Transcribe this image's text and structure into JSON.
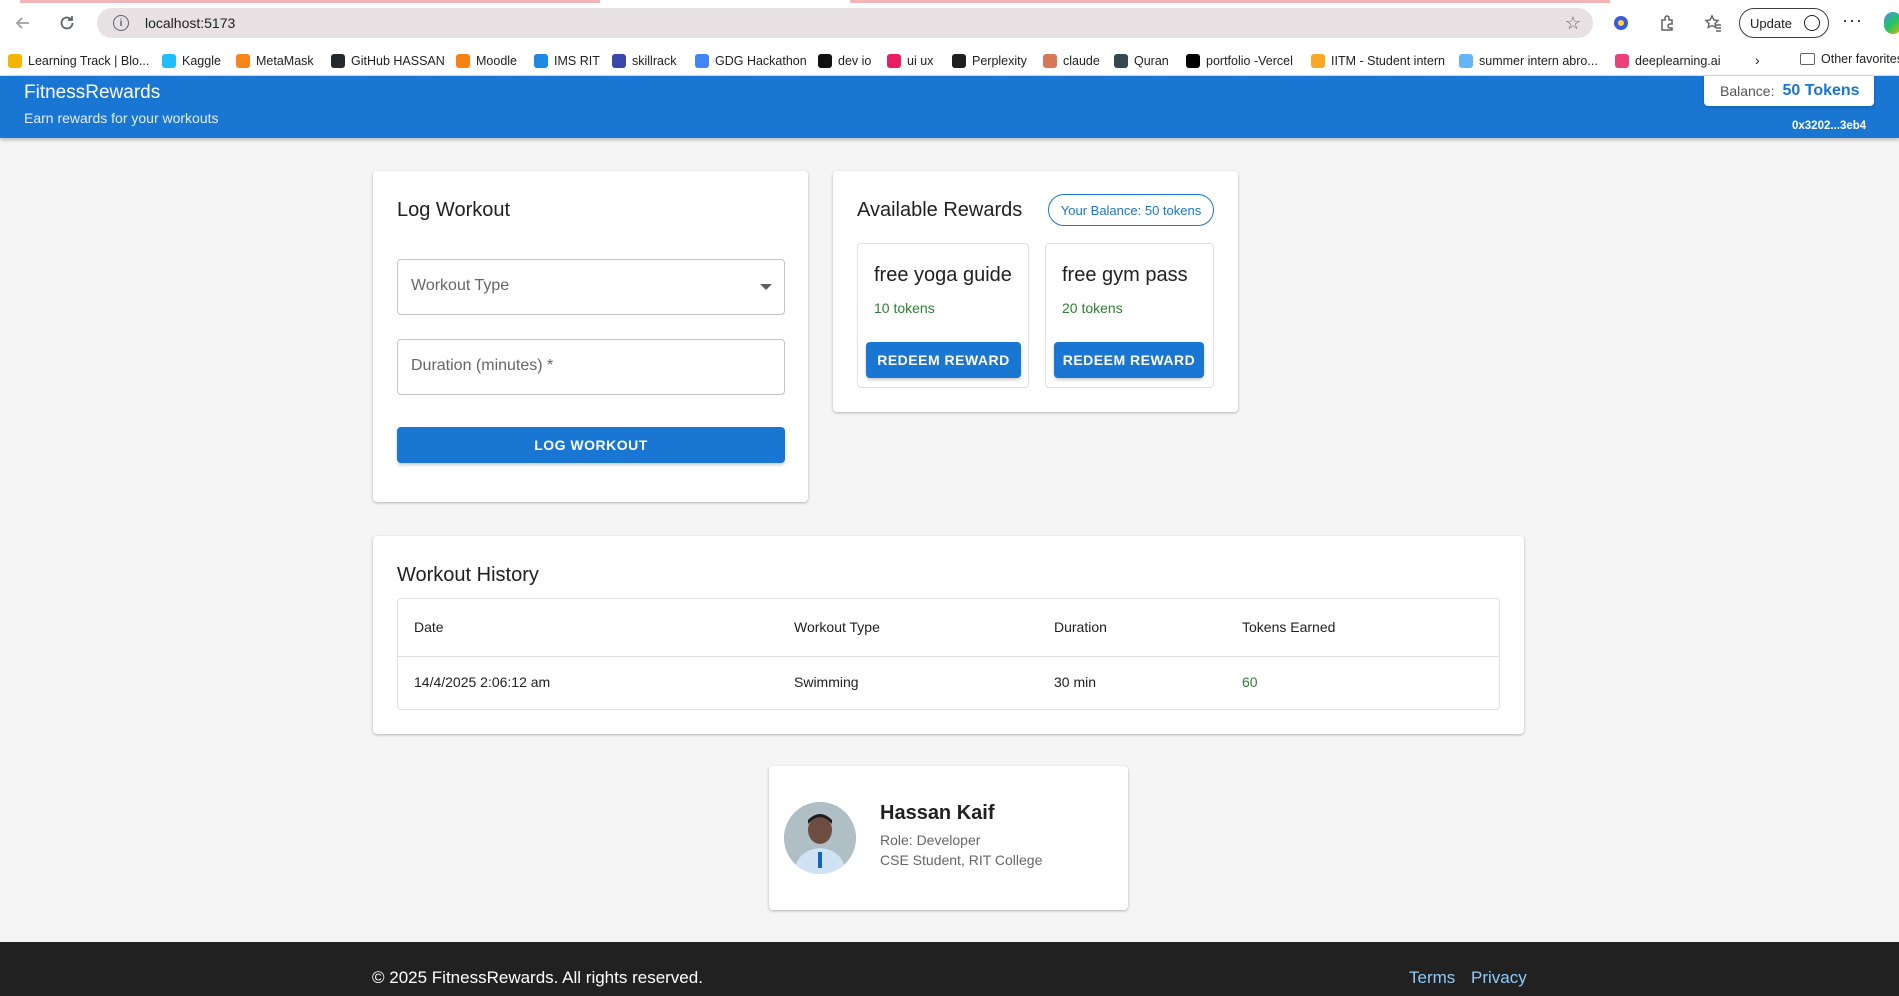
{
  "browser": {
    "url": "localhost:5173",
    "update_label": "Update",
    "bookmarks": [
      {
        "label": "Learning Track | Blo...",
        "color": "#f4b400"
      },
      {
        "label": "Kaggle",
        "color": "#20beff"
      },
      {
        "label": "MetaMask",
        "color": "#f6851b"
      },
      {
        "label": "GitHub HASSAN",
        "color": "#24292e"
      },
      {
        "label": "Moodle",
        "color": "#f98012"
      },
      {
        "label": "IMS RIT",
        "color": "#1e88e5"
      },
      {
        "label": "skillrack",
        "color": "#3949ab"
      },
      {
        "label": "GDG Hackathon",
        "color": "#4285f4"
      },
      {
        "label": "dev io",
        "color": "#111111"
      },
      {
        "label": "ui ux",
        "color": "#e91e63"
      },
      {
        "label": "Perplexity",
        "color": "#1f1f1f"
      },
      {
        "label": "claude",
        "color": "#d97757"
      },
      {
        "label": "Quran",
        "color": "#37474f"
      },
      {
        "label": "portfolio -Vercel",
        "color": "#000000"
      },
      {
        "label": "IITM - Student intern",
        "color": "#f9a825"
      },
      {
        "label": "summer intern abro...",
        "color": "#64b5f6"
      },
      {
        "label": "deeplearning.ai",
        "color": "#ec407a"
      }
    ],
    "other_bookmarks": "Other favorites"
  },
  "header": {
    "title": "FitnessRewards",
    "subtitle": "Earn rewards for your workouts",
    "balance_label": "Balance:",
    "balance_value": "50 Tokens",
    "wallet_address": "0x3202...3eb4"
  },
  "log_workout": {
    "title": "Log Workout",
    "workout_type_label": "Workout Type",
    "duration_label": "Duration (minutes) *",
    "submit_label": "LOG WORKOUT"
  },
  "rewards": {
    "title": "Available Rewards",
    "balance_chip": "Your Balance: 50 tokens",
    "items": [
      {
        "name": "free yoga guide",
        "cost": "10 tokens",
        "button": "REDEEM REWARD"
      },
      {
        "name": "free gym pass",
        "cost": "20 tokens",
        "button": "REDEEM REWARD"
      }
    ]
  },
  "history": {
    "title": "Workout History",
    "columns": [
      "Date",
      "Workout Type",
      "Duration",
      "Tokens Earned"
    ],
    "rows": [
      {
        "date": "14/4/2025 2:06:12 am",
        "type": "Swimming",
        "duration": "30 min",
        "tokens": "60"
      }
    ]
  },
  "profile": {
    "name": "Hassan Kaif",
    "role": "Role: Developer",
    "detail": "CSE Student, RIT College"
  },
  "footer": {
    "copyright": "© 2025 FitnessRewards. All rights reserved.",
    "terms": "Terms",
    "privacy": "Privacy"
  },
  "colors": {
    "primary": "#1976d2",
    "success": "#2e7d32",
    "footer_bg": "#212121"
  }
}
